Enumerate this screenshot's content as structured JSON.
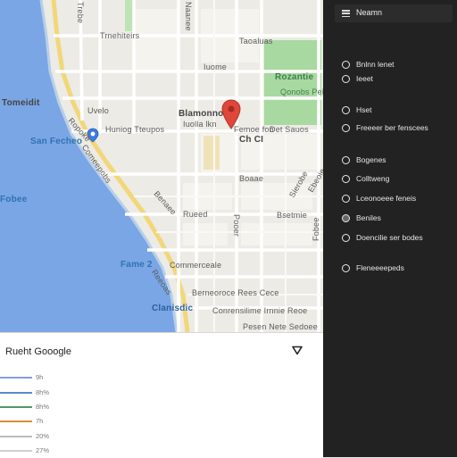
{
  "map": {
    "labels": {
      "upper_area": "Trnehiteirs",
      "top_road": "Taoaluas",
      "park_name": "Rozantie",
      "park_sub": "Qonobs Pelfa",
      "tomato": "Tomeidit",
      "area_a": "Uvelo",
      "hunting": "Huniog Tteupos",
      "place_name": "Blamonno",
      "place_sub": "Iuolla lkn",
      "street_east": "Femoe fon",
      "street_east2": "Det Sauos",
      "small_road": "Ch CI",
      "city": "San Fecheo",
      "shore": "Fobee",
      "area_mid": "Rueed",
      "area_mid2": "Comeepobs",
      "area_mid3": "Iuome",
      "area_mid4": "Bsetmie",
      "area_mid5": "Boaae",
      "bay": "Fame 2",
      "commerce": "Commerceale",
      "street_low": "Berneoroce Rees Cece",
      "place_blue": "Clanisdic",
      "street_bottom": "Conrensilime Irnnie Reoe",
      "street_bottom2": "Pesen Nete Sedoee",
      "diag1": "Ropoke",
      "diag2": "Benaee",
      "diag3": "Sierobe",
      "diag4": "Ebeoie",
      "diag5": "Reeoas",
      "vert1": "Trebe",
      "vert2": "Naanee",
      "vert3": "Pooer"
    }
  },
  "sidebar": {
    "title": "Neamn",
    "items": [
      {
        "label": "Bnlnn lenet"
      },
      {
        "label": "Ieeet"
      },
      {
        "label": "Hset"
      },
      {
        "label": "Freeeer ber fenscees"
      },
      {
        "label": "Bogenes"
      },
      {
        "label": "Colltweng"
      },
      {
        "label": "Lceonoeee feneis"
      },
      {
        "label": "Beniles"
      },
      {
        "label": "Doencilie ser bodes"
      },
      {
        "label": "Fleneeeepeds"
      }
    ]
  },
  "panel": {
    "title": "Rueht Gooogle",
    "legend": [
      {
        "label": "9h",
        "color": "#7ea0d8"
      },
      {
        "label": "8h%",
        "color": "#5b88cc"
      },
      {
        "label": "8h%",
        "color": "#4f9a63"
      },
      {
        "label": "7h",
        "color": "#e08a3a"
      },
      {
        "label": "20%",
        "color": "#bdbdbd"
      },
      {
        "label": "27%",
        "color": "#cfcfcf"
      }
    ]
  },
  "colors": {
    "water": "#7aa6e6",
    "park": "#a8d9a0",
    "highway": "#f2d77a",
    "pin": "#e0463a",
    "sidebar_bg": "#222222"
  }
}
